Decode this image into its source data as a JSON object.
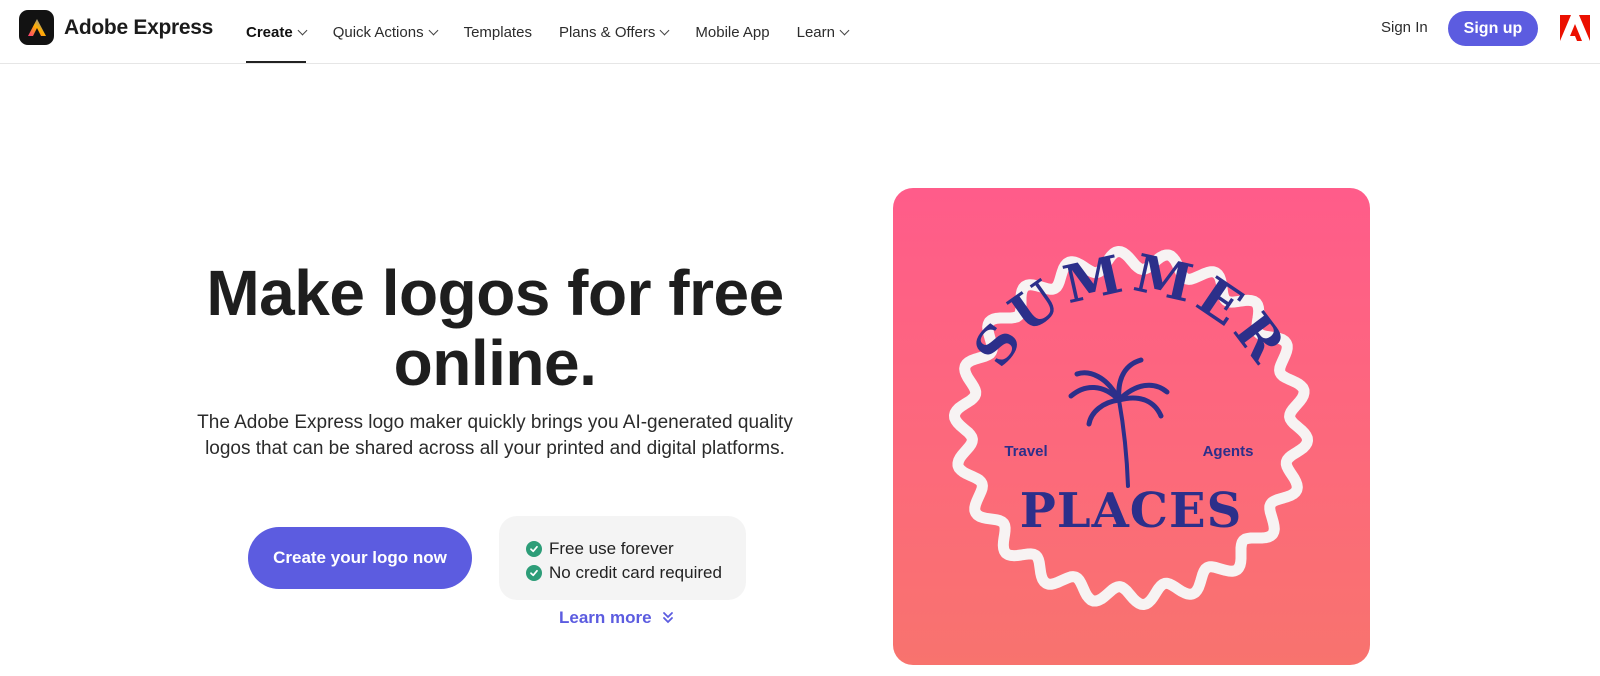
{
  "brand": {
    "name": "Adobe Express"
  },
  "nav": {
    "items": [
      {
        "label": "Create",
        "dropdown": true,
        "active": true
      },
      {
        "label": "Quick Actions",
        "dropdown": true
      },
      {
        "label": "Templates",
        "dropdown": false
      },
      {
        "label": "Plans & Offers",
        "dropdown": true
      },
      {
        "label": "Mobile App",
        "dropdown": false
      },
      {
        "label": "Learn",
        "dropdown": true
      }
    ],
    "sign_in": "Sign In",
    "sign_up": "Sign up"
  },
  "hero": {
    "title_line1": "Make logos for free",
    "title_line2": "online.",
    "subtitle_line1": "The Adobe Express logo maker quickly brings you AI-generated quality",
    "subtitle_line2": "logos that can be shared across all your printed and digital platforms.",
    "cta": "Create your logo now",
    "benefits": [
      "Free use forever",
      "No credit card required"
    ],
    "learn_more": "Learn more"
  },
  "sample_logo": {
    "arc_text": "SUMMER",
    "left_text": "Travel",
    "right_text": "Agents",
    "bottom_text": "PLACES"
  },
  "colors": {
    "accent": "#5c5ce0",
    "check": "#2d9d78",
    "card_top": "#ff5c8a",
    "card_bottom": "#f8736e",
    "logo_ink": "#2c2f8a"
  }
}
